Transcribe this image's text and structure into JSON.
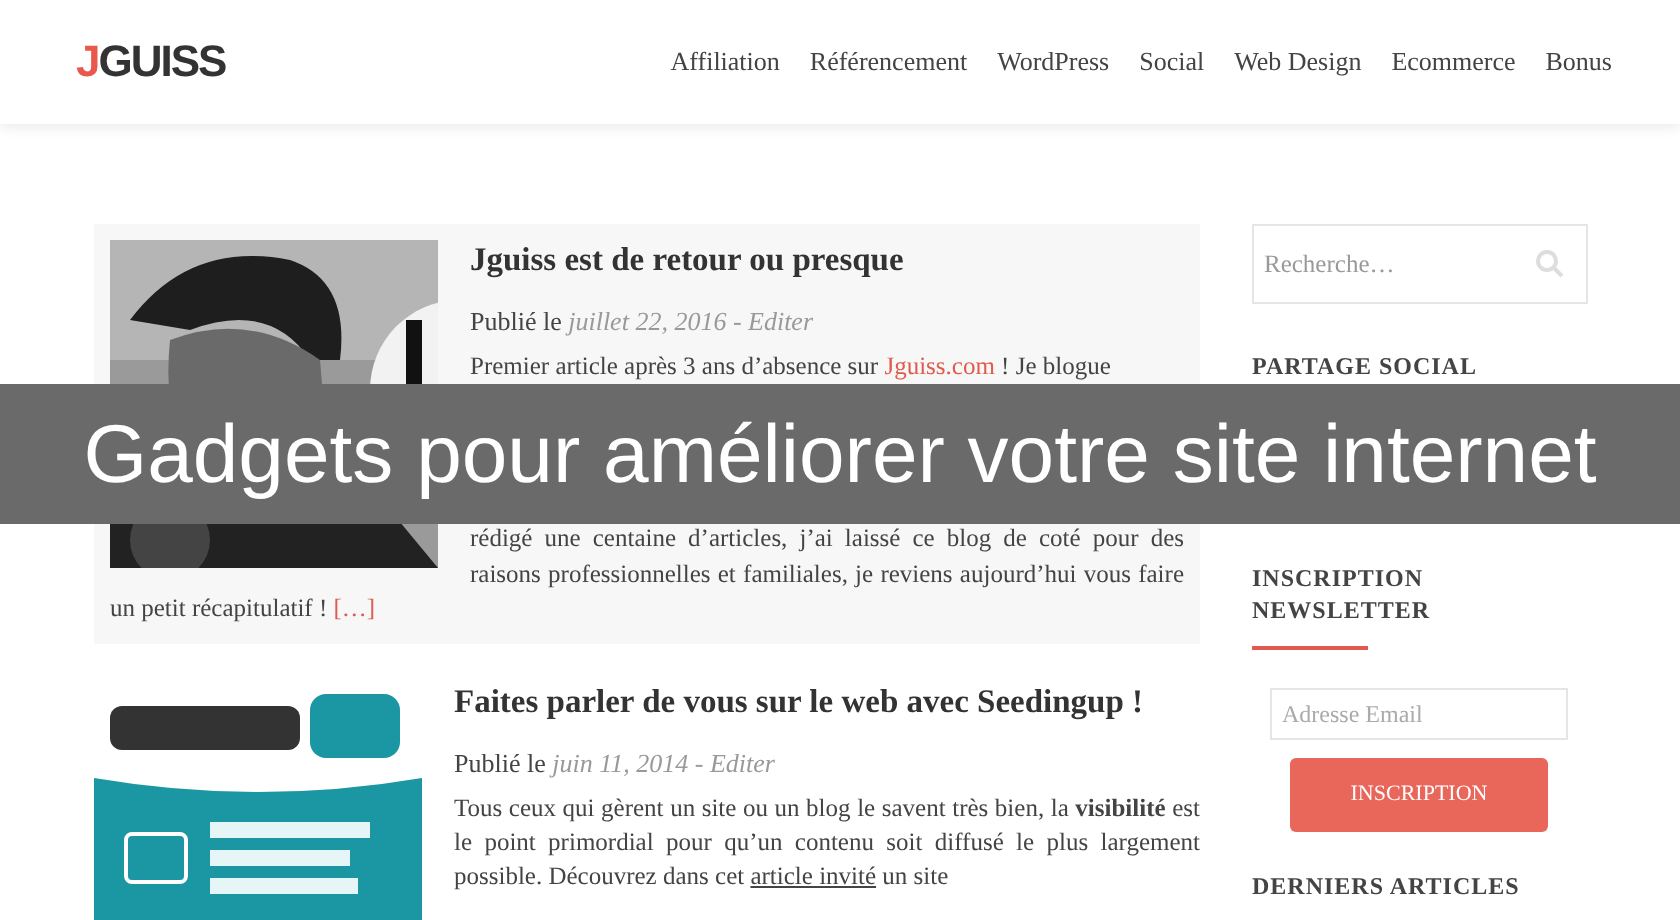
{
  "header": {
    "logo_initial": "J",
    "logo_rest": "GUISS",
    "nav": [
      "Affiliation",
      "Référencement",
      "WordPress",
      "Social",
      "Web Design",
      "Ecommerce",
      "Bonus"
    ]
  },
  "articles": [
    {
      "title": "Jguiss est de retour ou presque",
      "meta_label": "Publié le",
      "meta_date": "juillet 22, 2016 - Editer",
      "intro_before": "Premier article après 3 ans d’absence sur",
      "intro_link": "Jguiss.com",
      "intro_after": "! Je blogue",
      "body": "rédigé une centaine d’articles, j’ai laissé ce blog de coté pour des raisons professionnelles et familiales, je reviens aujourd’hui vous faire un petit récapitulatif !",
      "more": "[…]",
      "kind": "featured"
    },
    {
      "title": "Faites parler de vous sur le web avec Seedingup !",
      "meta_label": "Publié le",
      "meta_date": "juin 11, 2014 - Editer",
      "intro_before": "Tous ceux qui gèrent un site ou un blog le savent très bien, la **visibilité** est le point primordial pour qu’un contenu soit diffusé le plus largement possible. Découvrez dans cet",
      "intro_link": "article invité",
      "intro_after": "un site",
      "kind": "plain"
    }
  ],
  "sidebar": {
    "search": {
      "placeholder": "Recherche…"
    },
    "social_heading": "PARTAGE SOCIAL",
    "newsletter_heading": "INSCRIPTION NEWSLETTER",
    "email": {
      "placeholder": "Adresse Email"
    },
    "subscribe_button": "INSCRIPTION",
    "latest_heading": "DERNIERS ARTICLES"
  },
  "banner": "Gadgets pour améliorer votre site internet"
}
